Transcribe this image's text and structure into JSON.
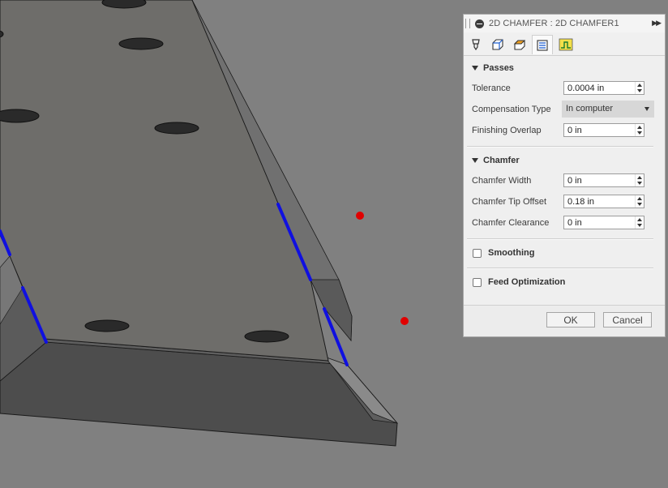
{
  "dialog": {
    "title": "2D CHAMFER : 2D CHAMFER1",
    "expand_glyph": "▶▶",
    "tabs": [
      {
        "icon": "tool-icon"
      },
      {
        "icon": "geometry-icon"
      },
      {
        "icon": "heights-icon"
      },
      {
        "icon": "passes-icon"
      },
      {
        "icon": "linking-icon"
      }
    ],
    "passes": {
      "heading": "Passes",
      "tolerance_label": "Tolerance",
      "tolerance_value": "0.0004 in",
      "compensation_label": "Compensation Type",
      "compensation_value": "In computer",
      "finishing_overlap_label": "Finishing Overlap",
      "finishing_overlap_value": "0 in"
    },
    "chamfer": {
      "heading": "Chamfer",
      "width_label": "Chamfer Width",
      "width_value": "0 in",
      "tip_offset_label": "Chamfer Tip Offset",
      "tip_offset_value": "0.18 in",
      "clearance_label": "Chamfer Clearance",
      "clearance_value": "0 in"
    },
    "smoothing_label": "Smoothing",
    "smoothing_checked": false,
    "feed_optimization_label": "Feed Optimization",
    "feed_optimization_checked": false,
    "ok_label": "OK",
    "cancel_label": "Cancel"
  },
  "viewport": {
    "background_color": "#808080",
    "part_top_color": "#6d6c69",
    "part_side_color": "#4b4b4b",
    "selected_edge_color": "#1010e0",
    "point_marker_color": "#e00000"
  }
}
